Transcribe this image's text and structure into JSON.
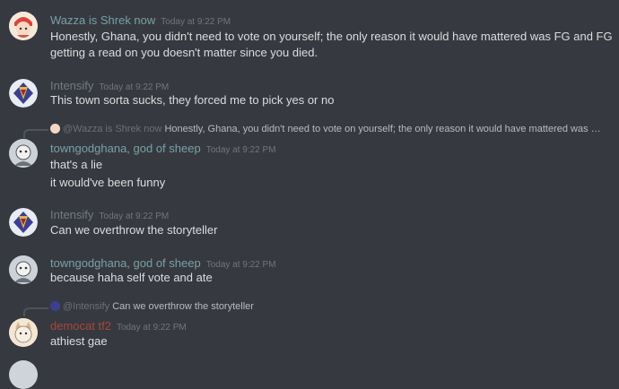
{
  "messages": [
    {
      "author": "Wazza is Shrek now",
      "author_color": "#7aa0a8",
      "timestamp": "Today at 9:22 PM",
      "lines": [
        "Honestly, Ghana, you didn't need to vote on yourself; the only reason it would have mattered was FG and FG",
        "getting a read on you doesn't matter since you died."
      ]
    },
    {
      "author": "Intensify",
      "author_color": "#727b86",
      "timestamp": "Today at 9:22 PM",
      "lines": [
        "This town sorta sucks, they forced me to pick yes or no"
      ]
    },
    {
      "reply": {
        "name": "@Wazza is Shrek now",
        "text": "Honestly, Ghana, you didn't need to vote on yourself; the only reason it would have mattered was FG ..."
      },
      "author": "towngodghana, god of sheep",
      "author_color": "#7aa0a8",
      "timestamp": "Today at 9:22 PM",
      "lines": [
        "that's a lie",
        "it would've been funny"
      ]
    },
    {
      "author": "Intensify",
      "author_color": "#727b86",
      "timestamp": "Today at 9:22 PM",
      "lines": [
        "Can we overthrow the storyteller"
      ]
    },
    {
      "author": "towngodghana, god of sheep",
      "author_color": "#7aa0a8",
      "timestamp": "Today at 9:22 PM",
      "lines": [
        "because haha self vote and ate"
      ]
    },
    {
      "reply": {
        "name": "@Intensify",
        "text": "Can we overthrow the storyteller"
      },
      "author": "democat tf2",
      "author_color": "#a8473d",
      "timestamp": "Today at 9:22 PM",
      "lines": [
        "athiest gae"
      ]
    }
  ]
}
